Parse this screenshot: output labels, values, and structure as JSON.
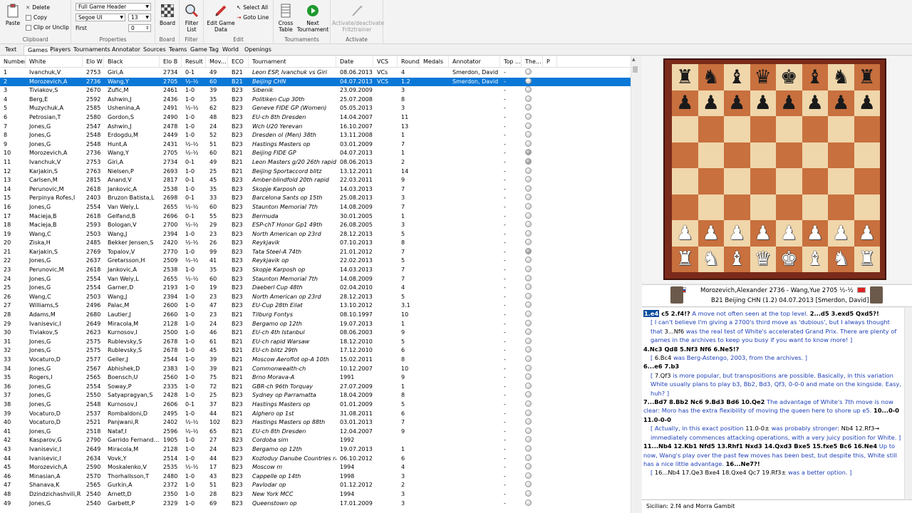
{
  "ribbon": {
    "paste": "Paste",
    "delete": "Delete",
    "copy": "Copy",
    "clip": "Clip or Unclip",
    "clipboard_label": "Clipboard",
    "header_select": "Full Game Header",
    "font_select": "Segoe UI",
    "font_size": "13",
    "first_label": "First",
    "first_value": "0",
    "properties_label": "Properties",
    "board": "Board",
    "board_label": "Board",
    "filter_list": "Filter List",
    "filter_label": "Filter",
    "edit_game_data": "Edit Game Data",
    "select_all": "Select All",
    "goto_line": "Goto Line",
    "edit_label": "Edit",
    "cross_table": "Cross Table",
    "next_tournament": "Next Tournament",
    "tournaments_label": "Tournaments",
    "fritztrainer": "Activate/deactivate Fritztrainer",
    "activate_label": "Activate"
  },
  "tabs": [
    "Text",
    "Games",
    "Players",
    "Tournaments",
    "Annotator",
    "Sources",
    "Teams",
    "Game Tag",
    "World",
    "Openings"
  ],
  "active_tab": "Games",
  "columns": [
    "Number",
    "White",
    "Elo W",
    "Black",
    "Elo B",
    "Result",
    "Mov...",
    "ECO",
    "Tournament",
    "Date",
    "VCS",
    "Round",
    "Medals",
    "Annotator",
    "Top ...",
    "The...",
    "P"
  ],
  "games": [
    [
      "1",
      "Ivanchuk,V",
      "2753",
      "Giri,A",
      "2734",
      "0-1",
      "49",
      "B21",
      "Leon ESP, Ivanchuk vs Giri",
      "08.06.2013",
      "VCs",
      "4",
      "",
      "Smerdon, David",
      "-",
      "o"
    ],
    [
      "2",
      "Morozevich,A",
      "2736",
      "Wang,Y",
      "2705",
      "½-½",
      "60",
      "B21",
      "Beijing CHN",
      "04.07.2013",
      "VCS",
      "1.2",
      "",
      "Smerdon, David",
      "-",
      "o"
    ],
    [
      "3",
      "Tiviakov,S",
      "2670",
      "Zufic,M",
      "2461",
      "1-0",
      "39",
      "B23",
      "Sibenik",
      "23.09.2009",
      "",
      "3",
      "",
      "",
      "-",
      "o"
    ],
    [
      "4",
      "Berg,E",
      "2592",
      "Ashwin,J",
      "2436",
      "1-0",
      "35",
      "B23",
      "Politiken Cup 30th",
      "25.07.2008",
      "",
      "8",
      "",
      "",
      "-",
      "o"
    ],
    [
      "5",
      "Muzychuk,A",
      "2585",
      "Ushenina,A",
      "2491",
      "½-½",
      "62",
      "B23",
      "Geneve FIDE GP (Women)",
      "05.05.2013",
      "",
      "3",
      "",
      "",
      "-",
      "o"
    ],
    [
      "6",
      "Petrosian,T",
      "2580",
      "Gordon,S",
      "2490",
      "1-0",
      "48",
      "B23",
      "EU-ch 8th Dresden",
      "14.04.2007",
      "",
      "11",
      "",
      "",
      "-",
      "o"
    ],
    [
      "7",
      "Jones,G",
      "2547",
      "Ashwin,J",
      "2478",
      "1-0",
      "24",
      "B23",
      "Wch U20 Yerevan",
      "16.10.2007",
      "",
      "13",
      "",
      "",
      "-",
      "o"
    ],
    [
      "8",
      "Jones,G",
      "2548",
      "Erdogdu,M",
      "2449",
      "1-0",
      "52",
      "B23",
      "Dresden ol (Men) 38th",
      "13.11.2008",
      "",
      "1",
      "",
      "",
      "-",
      "o"
    ],
    [
      "9",
      "Jones,G",
      "2548",
      "Hunt,A",
      "2431",
      "½-½",
      "51",
      "B23",
      "Hastings Masters op",
      "03.01.2009",
      "",
      "7",
      "",
      "",
      "-",
      "o"
    ],
    [
      "10",
      "Morozevich,A",
      "2736",
      "Wang,Y",
      "2705",
      "½-½",
      "60",
      "B21",
      "Beijing FIDE GP",
      "04.07.2013",
      "",
      "1",
      "",
      "",
      "-",
      "d"
    ],
    [
      "11",
      "Ivanchuk,V",
      "2753",
      "Giri,A",
      "2734",
      "0-1",
      "49",
      "B21",
      "Leon Masters g/20 26th rapid",
      "08.06.2013",
      "",
      "2",
      "",
      "",
      "-",
      "d"
    ],
    [
      "12",
      "Karjakin,S",
      "2763",
      "Nielsen,P",
      "2693",
      "1-0",
      "25",
      "B21",
      "Beijing Sportaccord blitz",
      "13.12.2011",
      "",
      "14",
      "",
      "",
      "-",
      "o"
    ],
    [
      "13",
      "Carlsen,M",
      "2815",
      "Anand,V",
      "2817",
      "0-1",
      "45",
      "B23",
      "Amber-blindfold 20th rapid",
      "22.03.2011",
      "",
      "9",
      "",
      "",
      "-",
      "o"
    ],
    [
      "14",
      "Perunovic,M",
      "2618",
      "Jankovic,A",
      "2538",
      "1-0",
      "35",
      "B23",
      "Skopje Karposh op",
      "14.03.2013",
      "",
      "7",
      "",
      "",
      "-",
      "o"
    ],
    [
      "15",
      "Perpinya Rofes,I",
      "2403",
      "Bruzon Batista,L",
      "2698",
      "0-1",
      "33",
      "B23",
      "Barcelona Sants op 15th",
      "25.08.2013",
      "",
      "3",
      "",
      "",
      "-",
      "o"
    ],
    [
      "16",
      "Jones,G",
      "2554",
      "Van Wely,L",
      "2655",
      "½-½",
      "60",
      "B23",
      "Staunton Memorial 7th",
      "14.08.2009",
      "",
      "7",
      "",
      "",
      "-",
      "o"
    ],
    [
      "17",
      "Macieja,B",
      "2618",
      "Gelfand,B",
      "2696",
      "0-1",
      "55",
      "B23",
      "Bermuda",
      "30.01.2005",
      "",
      "1",
      "",
      "",
      "-",
      "o"
    ],
    [
      "18",
      "Macieja,B",
      "2593",
      "Bologan,V",
      "2700",
      "½-½",
      "29",
      "B23",
      "ESP-chT Honor Gp1 49th",
      "26.08.2005",
      "",
      "3",
      "",
      "",
      "-",
      "o"
    ],
    [
      "19",
      "Wang,C",
      "2503",
      "Wang,J",
      "2394",
      "1-0",
      "23",
      "B23",
      "North American op 23rd",
      "28.12.2013",
      "",
      "5",
      "",
      "",
      "-",
      "o"
    ],
    [
      "20",
      "Ziska,H",
      "2485",
      "Bekker Jensen,S",
      "2420",
      "½-½",
      "26",
      "B23",
      "Reykjavik",
      "07.10.2013",
      "",
      "8",
      "",
      "",
      "-",
      "o"
    ],
    [
      "21",
      "Karjakin,S",
      "2769",
      "Topalov,V",
      "2770",
      "1-0",
      "99",
      "B23",
      "Tata Steel-A 74th",
      "21.01.2012",
      "",
      "7",
      "",
      "",
      "-",
      "d"
    ],
    [
      "22",
      "Jones,G",
      "2637",
      "Gretarsson,H",
      "2509",
      "½-½",
      "41",
      "B23",
      "Reykjavik op",
      "22.02.2013",
      "",
      "5",
      "",
      "",
      "-",
      "o"
    ],
    [
      "23",
      "Perunovic,M",
      "2618",
      "Jankovic,A",
      "2538",
      "1-0",
      "35",
      "B23",
      "Skopje Karposh op",
      "14.03.2013",
      "",
      "7",
      "",
      "",
      "-",
      "o"
    ],
    [
      "24",
      "Jones,G",
      "2554",
      "Van Wely,L",
      "2655",
      "½-½",
      "60",
      "B23",
      "Staunton Memorial 7th",
      "14.08.2009",
      "",
      "7",
      "",
      "",
      "-",
      "o"
    ],
    [
      "25",
      "Jones,G",
      "2554",
      "Garner,D",
      "2193",
      "1-0",
      "19",
      "B23",
      "Daeberl Cup 48th",
      "02.04.2010",
      "",
      "4",
      "",
      "",
      "-",
      "o"
    ],
    [
      "26",
      "Wang,C",
      "2503",
      "Wang,J",
      "2394",
      "1-0",
      "23",
      "B23",
      "North American op 23rd",
      "28.12.2013",
      "",
      "5",
      "",
      "",
      "-",
      "o"
    ],
    [
      "27",
      "Williams,S",
      "2496",
      "Palac,M",
      "2600",
      "1-0",
      "47",
      "B23",
      "EU-Cup 28th Eilat",
      "13.10.2012",
      "",
      "3.1",
      "",
      "",
      "-",
      "o"
    ],
    [
      "28",
      "Adams,M",
      "2680",
      "Lautier,J",
      "2660",
      "1-0",
      "23",
      "B21",
      "Tilburg Fontys",
      "08.10.1997",
      "",
      "10",
      "",
      "",
      "-",
      "o"
    ],
    [
      "29",
      "Ivanisevic,I",
      "2649",
      "Miracola,M",
      "2128",
      "1-0",
      "24",
      "B23",
      "Bergamo op 12th",
      "19.07.2013",
      "",
      "1",
      "",
      "",
      "-",
      "o"
    ],
    [
      "30",
      "Tiviakov,S",
      "2623",
      "Kurnosov,I",
      "2500",
      "1-0",
      "46",
      "B21",
      "EU-ch 4th Istanbul",
      "08.06.2003",
      "",
      "9",
      "",
      "",
      "-",
      "o"
    ],
    [
      "31",
      "Jones,G",
      "2575",
      "Rublevsky,S",
      "2678",
      "1-0",
      "61",
      "B21",
      "EU-ch rapid Warsaw",
      "18.12.2010",
      "",
      "5",
      "",
      "",
      "-",
      "o"
    ],
    [
      "32",
      "Jones,G",
      "2575",
      "Rublevsky,S",
      "2678",
      "1-0",
      "45",
      "B21",
      "EU-ch blitz 29th",
      "17.12.2010",
      "",
      "6",
      "",
      "",
      "-",
      "o"
    ],
    [
      "33",
      "Vocaturo,D",
      "2577",
      "Geller,J",
      "2544",
      "1-0",
      "39",
      "B21",
      "Moscow Aeroflot op-A 10th",
      "15.02.2011",
      "",
      "8",
      "",
      "",
      "-",
      "o"
    ],
    [
      "34",
      "Jones,G",
      "2567",
      "Abhishek,D",
      "2383",
      "1-0",
      "39",
      "B21",
      "Commonwealth-ch",
      "10.12.2007",
      "",
      "10",
      "",
      "",
      "-",
      "o"
    ],
    [
      "35",
      "Rogers,I",
      "2565",
      "Boensch,U",
      "2560",
      "1-0",
      "75",
      "B21",
      "Brno Morava-A",
      "1991",
      "",
      "9",
      "",
      "",
      "-",
      "o"
    ],
    [
      "36",
      "Jones,G",
      "2554",
      "Soway,P",
      "2335",
      "1-0",
      "72",
      "B21",
      "GBR-ch 96th Torquay",
      "27.07.2009",
      "",
      "1",
      "",
      "",
      "-",
      "o"
    ],
    [
      "37",
      "Jones,G",
      "2550",
      "Satyapragyan,S",
      "2428",
      "1-0",
      "25",
      "B23",
      "Sydney op Parramatta",
      "18.04.2009",
      "",
      "8",
      "",
      "",
      "-",
      "o"
    ],
    [
      "38",
      "Jones,G",
      "2548",
      "Kurnosov,I",
      "2606",
      "0-1",
      "37",
      "B23",
      "Hastings Masters op",
      "01.01.2009",
      "",
      "5",
      "",
      "",
      "-",
      "o"
    ],
    [
      "39",
      "Vocaturo,D",
      "2537",
      "Rombaldoni,D",
      "2495",
      "1-0",
      "44",
      "B21",
      "Alghero op 1st",
      "31.08.2011",
      "",
      "6",
      "",
      "",
      "-",
      "o"
    ],
    [
      "40",
      "Vocaturo,D",
      "2521",
      "Panjwani,R",
      "2402",
      "½-½",
      "102",
      "B23",
      "Hastings Masters op 88th",
      "03.01.2013",
      "",
      "7",
      "",
      "",
      "-",
      "o"
    ],
    [
      "41",
      "Jones,G",
      "2518",
      "Nataf,I",
      "2596",
      "½-½",
      "65",
      "B21",
      "EU-ch 8th Dresden",
      "12.04.2007",
      "",
      "9",
      "",
      "",
      "-",
      "o"
    ],
    [
      "42",
      "Kasparov,G",
      "2790",
      "Garrido Fernand...",
      "1905",
      "1-0",
      "27",
      "B23",
      "Cordoba sim",
      "1992",
      "",
      "",
      "",
      "",
      "-",
      "o"
    ],
    [
      "43",
      "Ivanisevic,I",
      "2649",
      "Miracola,M",
      "2128",
      "1-0",
      "24",
      "B23",
      "Bergamo op 12th",
      "19.07.2013",
      "",
      "1",
      "",
      "",
      "-",
      "o"
    ],
    [
      "44",
      "Ivanisevic,I",
      "2634",
      "Vovk,Y",
      "2514",
      "1-0",
      "44",
      "B23",
      "Kozloduy Danube Countries ra..",
      "06.10.2012",
      "",
      "6",
      "",
      "",
      "-",
      "o"
    ],
    [
      "45",
      "Morozevich,A",
      "2590",
      "Moskalenko,V",
      "2535",
      "½-½",
      "17",
      "B23",
      "Moscow m",
      "1994",
      "",
      "4",
      "",
      "",
      "-",
      "o"
    ],
    [
      "46",
      "Minasian,A",
      "2570",
      "Thorhallsson,T",
      "2480",
      "1-0",
      "43",
      "B23",
      "Cappelle op 14th",
      "1998",
      "",
      "3",
      "",
      "",
      "-",
      "o"
    ],
    [
      "47",
      "Shanava,K",
      "2565",
      "Gurkin,A",
      "2372",
      "1-0",
      "51",
      "B23",
      "Pavlodar op",
      "01.12.2012",
      "",
      "2",
      "",
      "",
      "-",
      "o"
    ],
    [
      "48",
      "Dzindzichashvili,R",
      "2540",
      "Arnett,D",
      "2350",
      "1-0",
      "28",
      "B23",
      "New York MCC",
      "1994",
      "",
      "3",
      "",
      "",
      "-",
      "o"
    ],
    [
      "49",
      "Jones,G",
      "2540",
      "Garbett,P",
      "2329",
      "1-0",
      "69",
      "B23",
      "Queenstown op",
      "17.01.2009",
      "",
      "3",
      "",
      "",
      "-",
      "o"
    ]
  ],
  "selected_row": 1,
  "board_position": [
    [
      "r",
      "n",
      "b",
      "q",
      "k",
      "b",
      "n",
      "r"
    ],
    [
      "p",
      "p",
      "p",
      "p",
      "p",
      "p",
      "p",
      "p"
    ],
    [
      "",
      "",
      "",
      "",
      "",
      "",
      "",
      ""
    ],
    [
      "",
      "",
      "",
      "",
      "",
      "",
      "",
      ""
    ],
    [
      "",
      "",
      "",
      "",
      "",
      "",
      "",
      ""
    ],
    [
      "",
      "",
      "",
      "",
      "",
      "",
      "",
      ""
    ],
    [
      "P",
      "P",
      "P",
      "P",
      "P",
      "P",
      "P",
      "P"
    ],
    [
      "R",
      "N",
      "B",
      "Q",
      "K",
      "B",
      "N",
      "R"
    ]
  ],
  "game_header": {
    "line1": "Morozevich,Alexander 2736 - Wang,Yue 2705 ½-½",
    "line2": "B21 Beijing CHN (1.2) 04.07.2013 [Smerdon, David]"
  },
  "notation": [
    {
      "type": "main",
      "parts": [
        [
          "cur",
          "1.e4"
        ],
        [
          "mv",
          " c5 2.f4!?"
        ],
        [
          "cm",
          " A move not often seen at the top level. "
        ],
        [
          "mv",
          "2...d5 3.exd5 Qxd5?!"
        ]
      ]
    },
    {
      "type": "var",
      "parts": [
        [
          "cm",
          "[ I can't believe I'm giving a 2700's third move as 'dubious', but I always thought that "
        ],
        [
          "vm",
          "3...Nf6"
        ],
        [
          "cm",
          " was the real test of White's accelerated Grand Prix. There are plenty of games in the archives to keep you busy if you want to know more! ]"
        ]
      ]
    },
    {
      "type": "main",
      "parts": [
        [
          "mv",
          "4.Nc3 Qd8 5.Nf3 Nf6 6.Ne5!?"
        ]
      ]
    },
    {
      "type": "var",
      "parts": [
        [
          "cm",
          "[ "
        ],
        [
          "vm",
          "6.Bc4"
        ],
        [
          "cm",
          " was Berg-Astengo, 2003, from the archives. ]"
        ]
      ]
    },
    {
      "type": "main",
      "parts": [
        [
          "mv",
          "6...e6 7.b3"
        ]
      ]
    },
    {
      "type": "var",
      "parts": [
        [
          "cm",
          "[ "
        ],
        [
          "vm",
          "7.Qf3"
        ],
        [
          "cm",
          " is more popular, but transpositions are possible. Basically, in this variation White usually plans to play b3, Bb2, Bd3, Qf3, 0-0-0 and mate on the kingside. Easy, huh? ]"
        ]
      ]
    },
    {
      "type": "main",
      "parts": [
        [
          "mv",
          "7...Bd7 8.Bb2 Nc6 9.Bd3 Bd6 10.Qe2"
        ],
        [
          "cm",
          " The advantage of White's 7th move is now clear: Moro has the extra flexibility of moving the queen here to shore up e5. "
        ],
        [
          "mv",
          "10...0-0 11.0-0-0"
        ]
      ]
    },
    {
      "type": "var",
      "parts": [
        [
          "cm",
          "[ Actually, in this exact position "
        ],
        [
          "vm",
          "11.0-0±"
        ],
        [
          "cm",
          " was probably stronger: "
        ],
        [
          "vm",
          "Nb4 12.Rf3→"
        ],
        [
          "cm",
          " immediately commences attacking operations, with a very juicy position for White. ]"
        ]
      ]
    },
    {
      "type": "main",
      "parts": [
        [
          "mv",
          "11...Nb4 12.Kb1 Nfd5 13.Rhf1 Nxd3 14.Qxd3 Bxe5 15.fxe5 Bc6 16.Ne4"
        ],
        [
          "cm",
          " Up to now, Wang's play over the past few moves has been best, but despite this, White still has a nice little advantage. "
        ],
        [
          "mv",
          "16...Ne7?!"
        ]
      ]
    },
    {
      "type": "var",
      "parts": [
        [
          "cm",
          "[ "
        ],
        [
          "vm",
          "16...Nb4 17.Qe3 Bxe4 18.Qxe4 Qc7 19.Rf3±"
        ],
        [
          "cm",
          " was a better option. ]"
        ]
      ]
    }
  ],
  "status": "Sicilian: 2.f4 and Morra Gambit"
}
